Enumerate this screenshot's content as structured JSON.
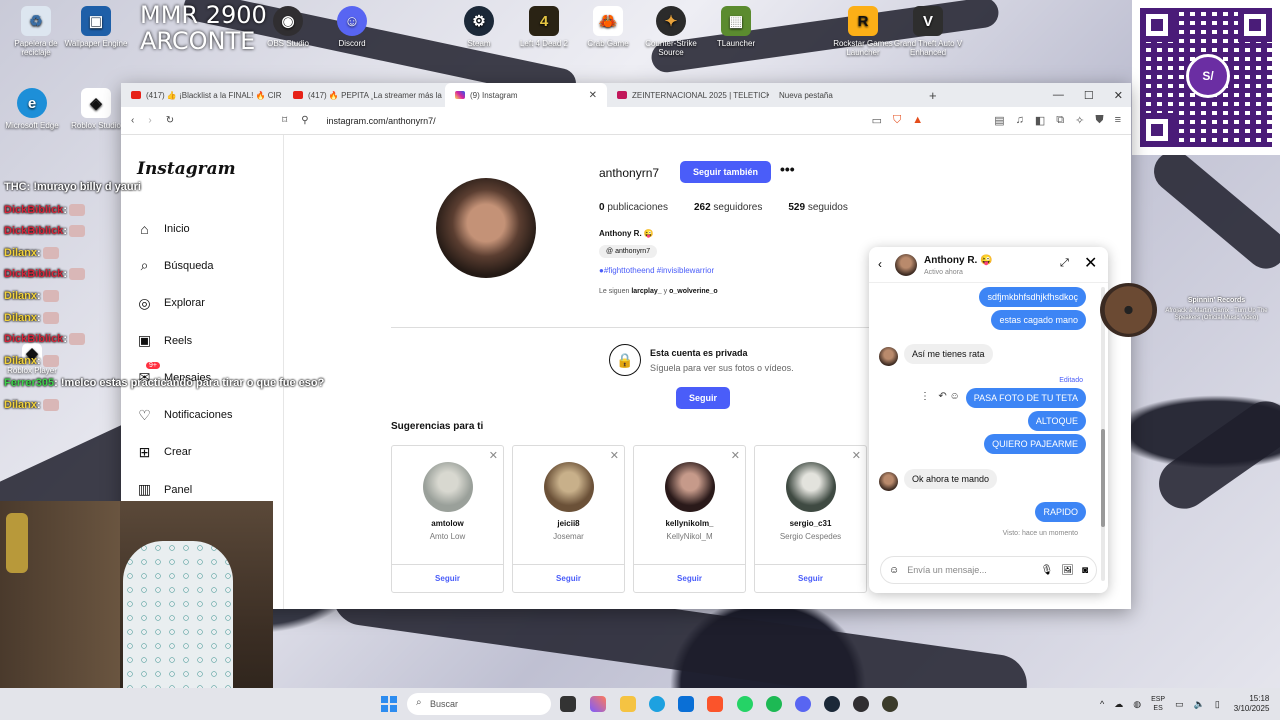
{
  "desktop": {
    "overlay_title_line1": "MMR 2900",
    "overlay_title_line2": "ARCONTE",
    "icons": [
      {
        "label": "Papelera de reciclaje",
        "icon": "recycle-bin-icon"
      },
      {
        "label": "Wallpaper Engine",
        "icon": "wallpaper-engine-icon"
      },
      {
        "label": "OBS Studio",
        "icon": "obs-icon"
      },
      {
        "label": "Discord",
        "icon": "discord-icon"
      },
      {
        "label": "Steam",
        "icon": "steam-icon"
      },
      {
        "label": "Left 4 Dead 2",
        "icon": "l4d2-icon"
      },
      {
        "label": "Crab Game",
        "icon": "crab-game-icon"
      },
      {
        "label": "Counter-Strike Source",
        "icon": "css-icon"
      },
      {
        "label": "TLauncher",
        "icon": "tlauncher-icon"
      },
      {
        "label": "Rockstar Games Launcher",
        "icon": "rockstar-icon"
      },
      {
        "label": "Grand Theft Auto V Enhanced",
        "icon": "gta-icon"
      },
      {
        "label": "Microsoft Edge",
        "icon": "edge-icon"
      },
      {
        "label": "Roblox Studio",
        "icon": "roblox-studio-icon"
      },
      {
        "label": "Roblox Player",
        "icon": "roblox-icon"
      }
    ]
  },
  "stream_chat": [
    {
      "user": "THC",
      "msg": ": !murayo billy d yauri",
      "color": "white"
    },
    {
      "user": "DickBiblick",
      "msg": ":",
      "color": "red"
    },
    {
      "user": "DickBiblick",
      "msg": ":",
      "color": "red"
    },
    {
      "user": "Dilanx",
      "msg": ":",
      "color": "yellow"
    },
    {
      "user": "DickBiblick",
      "msg": ":",
      "color": "red"
    },
    {
      "user": "Dilanx",
      "msg": ":",
      "color": "yellow"
    },
    {
      "user": "Dilanx",
      "msg": ":",
      "color": "yellow"
    },
    {
      "user": "DickBiblick",
      "msg": ":",
      "color": "red"
    },
    {
      "user": "Dilanx",
      "msg": ":",
      "color": "yellow"
    },
    {
      "user": "Ferrer305",
      "msg": ": !melco estas practicando para tirar o que fue eso?",
      "color": "green"
    },
    {
      "user": "Dilanx",
      "msg": ":",
      "color": "yellow"
    }
  ],
  "spinnin": {
    "title": "Spinnin' Records",
    "subtitle": "Afrojack & Martin Garrix - Turn Up The Speakers (Official Music Video)"
  },
  "browser": {
    "tabs": [
      {
        "label": "(417) 👍 ¡Blacklist a la FINAL! 🔥 CIR",
        "fav": "#e62117"
      },
      {
        "label": "(417) 🔥 PEPITA ¸La streamer más la",
        "fav": "#e62117"
      },
      {
        "label": "(9) Instagram",
        "fav": "#d6249f",
        "active": true
      },
      {
        "label": "ZEINTERNACIONAL 2025 | TELETICK",
        "fav": "#c2185b"
      },
      {
        "label": "Nueva pestaña",
        "fav": "transparent"
      }
    ],
    "url": "instagram.com/anthonyrn7/"
  },
  "instagram": {
    "logo": "Instagram",
    "nav": [
      {
        "label": "Inicio",
        "icon": "home-icon",
        "glyph": "⌂"
      },
      {
        "label": "Búsqueda",
        "icon": "search-icon",
        "glyph": "⌕"
      },
      {
        "label": "Explorar",
        "icon": "compass-icon",
        "glyph": "◎"
      },
      {
        "label": "Reels",
        "icon": "reels-icon",
        "glyph": "▣"
      },
      {
        "label": "Mensajes",
        "icon": "messenger-icon",
        "glyph": "✉",
        "badge": "9+"
      },
      {
        "label": "Notificaciones",
        "icon": "heart-icon",
        "glyph": "♡"
      },
      {
        "label": "Crear",
        "icon": "plus-icon",
        "glyph": "⊞"
      },
      {
        "label": "Panel",
        "icon": "chart-icon",
        "glyph": "▥"
      }
    ],
    "profile": {
      "username": "anthonyrn7",
      "follow_back_label": "Seguir también",
      "posts": "0",
      "posts_label": "publicaciones",
      "followers": "262",
      "followers_label": "seguidores",
      "following": "529",
      "following_label": "seguidos",
      "full_name": "Anthony R. 😜",
      "threads_handle": "anthonyrn7",
      "bio": "●#fighttotheend #invisiblewarrior",
      "followed_by_prefix": "Le siguen",
      "followed_by_1": "larcplay_",
      "followed_by_and": "y",
      "followed_by_2": "o_wolverine_o"
    },
    "private": {
      "title": "Esta cuenta es privada",
      "subtitle": "Síguela para ver sus fotos o vídeos.",
      "button": "Seguir"
    },
    "suggestions_title": "Sugerencias para ti",
    "suggestions": [
      {
        "username": "amtolow",
        "name": "Amto Low",
        "button": "Seguir",
        "color": "#9aa09a"
      },
      {
        "username": "jeicii8",
        "name": "Josemar",
        "button": "Seguir",
        "color": "#8a6e50"
      },
      {
        "username": "kellynikolm_",
        "name": "KellyNikol_M",
        "button": "Seguir",
        "color": "#3a2a2a"
      },
      {
        "username": "sergio_c31",
        "name": "Sergio Cespedes",
        "button": "Seguir",
        "color": "#56625a"
      }
    ]
  },
  "dm": {
    "name": "Anthony R. 😜",
    "status": "Activo ahora",
    "messages": [
      {
        "side": "out",
        "text": "sdfjmkbhfsdhjkfhsdkoç"
      },
      {
        "side": "out",
        "text": "estas cagado mano"
      },
      {
        "side": "in",
        "text": "Así me tienes rata"
      },
      {
        "side": "out",
        "text": "PASA FOTO DE TU TETA"
      },
      {
        "side": "out",
        "text": "ALTOQUE"
      },
      {
        "side": "out",
        "text": "QUIERO PAJEARME"
      },
      {
        "side": "in",
        "text": "Ok ahora te mando"
      },
      {
        "side": "out",
        "text": "RAPIDO"
      }
    ],
    "edited_label": "Editado",
    "seen_label": "Visto: hace un momento",
    "composer_placeholder": "Envía un mensaje..."
  },
  "taskbar": {
    "search_placeholder": "Buscar",
    "lang_line1": "ESP",
    "lang_line2": "ES",
    "time": "15:18",
    "date": "3/10/2025"
  }
}
